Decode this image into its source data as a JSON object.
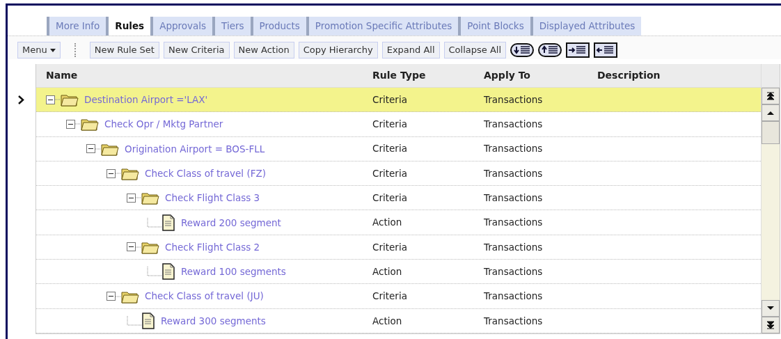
{
  "tabs": [
    {
      "label": "More Info",
      "selected": false
    },
    {
      "label": "Rules",
      "selected": true
    },
    {
      "label": "Approvals",
      "selected": false
    },
    {
      "label": "Tiers",
      "selected": false
    },
    {
      "label": "Products",
      "selected": false
    },
    {
      "label": "Promotion Specific Attributes",
      "selected": false
    },
    {
      "label": "Point Blocks",
      "selected": false
    },
    {
      "label": "Displayed Attributes",
      "selected": false
    }
  ],
  "toolbar": {
    "menu": "Menu",
    "buttons": [
      "New Rule Set",
      "New Criteria",
      "New Action",
      "Copy Hierarchy",
      "Expand All",
      "Collapse All"
    ],
    "icon_buttons": [
      {
        "kind": "move_down"
      },
      {
        "kind": "move_up"
      },
      {
        "kind": "indent"
      },
      {
        "kind": "outdent"
      }
    ]
  },
  "table": {
    "columns": [
      "Name",
      "Rule Type",
      "Apply To",
      "Description"
    ],
    "rows": [
      {
        "name": "Destination Airport ='LAX'",
        "rule_type": "Criteria",
        "apply_to": "Transactions",
        "kind": "folder",
        "expanded": true,
        "selected": true,
        "children": [
          {
            "name": "Check Opr / Mktg Partner",
            "rule_type": "Criteria",
            "apply_to": "Transactions",
            "kind": "folder",
            "expanded": true,
            "selected": false,
            "children": [
              {
                "name": "Origination Airport = BOS-FLL",
                "rule_type": "Criteria",
                "apply_to": "Transactions",
                "kind": "folder",
                "expanded": true,
                "selected": false,
                "children": [
                  {
                    "name": "Check Class of travel (FZ)",
                    "rule_type": "Criteria",
                    "apply_to": "Transactions",
                    "kind": "folder",
                    "expanded": true,
                    "selected": false,
                    "children": [
                      {
                        "name": "Check Flight Class 3",
                        "rule_type": "Criteria",
                        "apply_to": "Transactions",
                        "kind": "folder",
                        "expanded": true,
                        "selected": false,
                        "children": [
                          {
                            "name": "Reward 200 segment",
                            "rule_type": "Action",
                            "apply_to": "Transactions",
                            "kind": "document",
                            "selected": false
                          }
                        ]
                      },
                      {
                        "name": "Check Flight Class 2",
                        "rule_type": "Criteria",
                        "apply_to": "Transactions",
                        "kind": "folder",
                        "expanded": true,
                        "selected": false,
                        "children": [
                          {
                            "name": "Reward 100 segments",
                            "rule_type": "Action",
                            "apply_to": "Transactions",
                            "kind": "document",
                            "selected": false
                          }
                        ]
                      }
                    ]
                  },
                  {
                    "name": "Check Class of travel (JU)",
                    "rule_type": "Criteria",
                    "apply_to": "Transactions",
                    "kind": "folder",
                    "expanded": true,
                    "selected": false,
                    "children": [
                      {
                        "name": "Reward 300 segments",
                        "rule_type": "Action",
                        "apply_to": "Transactions",
                        "kind": "document",
                        "selected": false
                      }
                    ]
                  }
                ]
              }
            ]
          }
        ]
      }
    ]
  }
}
